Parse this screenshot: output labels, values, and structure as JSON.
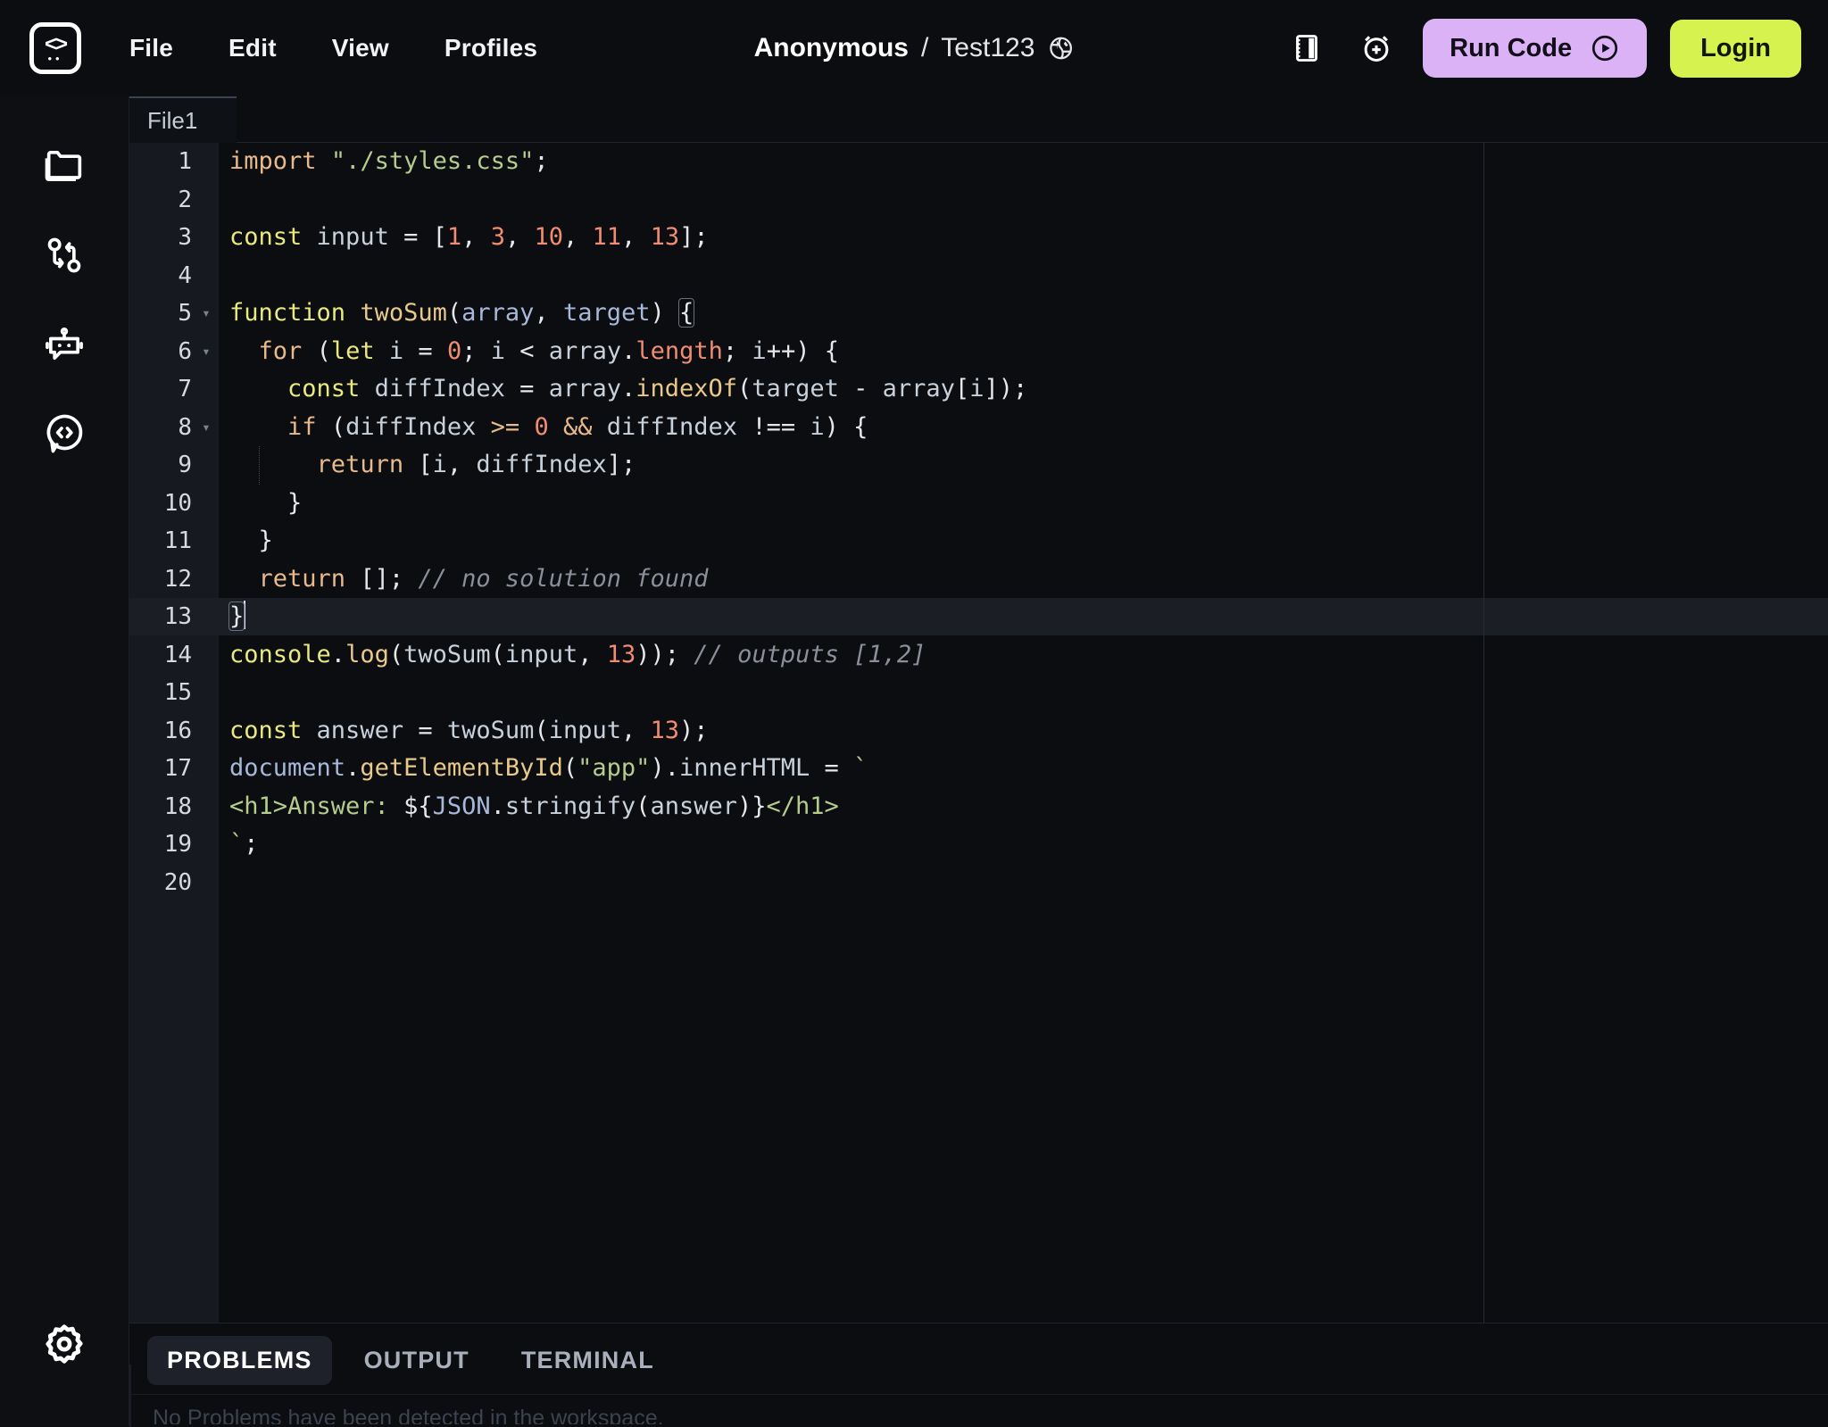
{
  "app": {
    "logo_icon": "code-brackets-logo-icon",
    "menus": [
      "File",
      "Edit",
      "View",
      "Profiles"
    ]
  },
  "header": {
    "owner": "Anonymous",
    "separator": "/",
    "project": "Test123",
    "globe_icon": "globe-icon",
    "notebook_icon": "notebook-panel-icon",
    "timer_icon": "alarm-add-icon",
    "run_label": "Run Code",
    "run_icon": "play-circle-icon",
    "run_bg": "#DBB2F5",
    "login_label": "Login",
    "login_bg": "#D6F24F"
  },
  "activity_bar": {
    "items": [
      {
        "name": "files",
        "icon": "folder-icon"
      },
      {
        "name": "source-control",
        "icon": "git-branch-icon"
      },
      {
        "name": "ai-assistant",
        "icon": "robot-icon"
      },
      {
        "name": "code-chat",
        "icon": "code-chat-bubble-icon"
      }
    ],
    "bottom": {
      "name": "settings",
      "icon": "gear-icon"
    }
  },
  "editor": {
    "tab_label": "File1",
    "active_line": 13,
    "lines": [
      {
        "n": 1,
        "fold": "",
        "html": "<span class=\"kw2\">import</span> <span class=\"str\">\"./styles.css\"</span><span class=\"pun\">;</span>"
      },
      {
        "n": 2,
        "fold": "",
        "html": ""
      },
      {
        "n": 3,
        "fold": "",
        "html": "<span class=\"kw\">const</span> <span class=\"id\">input</span> <span class=\"pun\">=</span> <span class=\"pun\">[</span><span class=\"num\">1</span><span class=\"pun\">,</span> <span class=\"num\">3</span><span class=\"pun\">,</span> <span class=\"num\">10</span><span class=\"pun\">,</span> <span class=\"num\">11</span><span class=\"pun\">,</span> <span class=\"num\">13</span><span class=\"pun\">];</span>"
      },
      {
        "n": 4,
        "fold": "",
        "html": ""
      },
      {
        "n": 5,
        "fold": "▾",
        "html": "<span class=\"kw\">function</span> <span class=\"fn\">twoSum</span><span class=\"pun\">(</span><span class=\"param\">array</span><span class=\"pun\">,</span> <span class=\"param\">target</span><span class=\"pun\">)</span> <span class=\"pun brmatch\">{</span>"
      },
      {
        "n": 6,
        "fold": "▾",
        "html": "  <span class=\"kw2\">for</span> <span class=\"pun\">(</span><span class=\"kw\">let</span> <span class=\"id\">i</span> <span class=\"pun\">=</span> <span class=\"num\">0</span><span class=\"pun\">;</span> <span class=\"id\">i</span> <span class=\"pun\">&lt;</span> <span class=\"id\">array</span><span class=\"pun\">.</span><span class=\"prop\">length</span><span class=\"pun\">;</span> <span class=\"id\">i</span><span class=\"pun\">++)</span> <span class=\"pun\">{</span>"
      },
      {
        "n": 7,
        "fold": "",
        "html": "    <span class=\"kw\">const</span> <span class=\"id\">diffIndex</span> <span class=\"pun\">=</span> <span class=\"id\">array</span><span class=\"pun\">.</span><span class=\"fn\">indexOf</span><span class=\"pun\">(</span><span class=\"id\">target</span> <span class=\"pun\">-</span> <span class=\"id\">array</span><span class=\"pun\">[</span><span class=\"id\">i</span><span class=\"pun\">]);</span>"
      },
      {
        "n": 8,
        "fold": "▾",
        "html": "    <span class=\"kw2\">if</span> <span class=\"pun\">(</span><span class=\"id\">diffIndex</span> <span class=\"kw2\">&gt;=</span> <span class=\"num\">0</span> <span class=\"kw2\">&amp;&amp;</span> <span class=\"id\">diffIndex</span> <span class=\"pun\">!==</span> <span class=\"id\">i</span><span class=\"pun\">)</span> <span class=\"pun\">{</span>"
      },
      {
        "n": 9,
        "fold": "",
        "html": "      <span class=\"kw2\">return</span> <span class=\"pun\">[</span><span class=\"id\">i</span><span class=\"pun\">,</span> <span class=\"id\">diffIndex</span><span class=\"pun\">];</span>"
      },
      {
        "n": 10,
        "fold": "",
        "html": "    <span class=\"pun\">}</span>"
      },
      {
        "n": 11,
        "fold": "",
        "html": "  <span class=\"pun\">}</span>"
      },
      {
        "n": 12,
        "fold": "",
        "html": "  <span class=\"kw2\">return</span> <span class=\"pun\">[];</span> <span class=\"cmt\">// no solution found</span>"
      },
      {
        "n": 13,
        "fold": "",
        "html": "<span class=\"pun brmatch\">}</span><span class=\"cursor\"></span>"
      },
      {
        "n": 14,
        "fold": "",
        "html": "<span class=\"kw\">console</span><span class=\"pun\">.</span><span class=\"fn\">log</span><span class=\"pun\">(</span><span class=\"id\">twoSum</span><span class=\"pun\">(</span><span class=\"id\">input</span><span class=\"pun\">,</span> <span class=\"num\">13</span><span class=\"pun\">));</span> <span class=\"cmt\">// outputs [1,2]</span>"
      },
      {
        "n": 15,
        "fold": "",
        "html": ""
      },
      {
        "n": 16,
        "fold": "",
        "html": "<span class=\"kw\">const</span> <span class=\"id\">answer</span> <span class=\"pun\">=</span> <span class=\"id\">twoSum</span><span class=\"pun\">(</span><span class=\"id\">input</span><span class=\"pun\">,</span> <span class=\"num\">13</span><span class=\"pun\">);</span>"
      },
      {
        "n": 17,
        "fold": "",
        "html": "<span class=\"obj\">document</span><span class=\"pun\">.</span><span class=\"fn\">getElementById</span><span class=\"pun\">(</span><span class=\"str\">\"app\"</span><span class=\"pun\">).</span><span class=\"id\">innerHTML</span> <span class=\"pun\">=</span> <span class=\"str\">`</span>"
      },
      {
        "n": 18,
        "fold": "",
        "html": "<span class=\"tag\">&lt;h1&gt;Answer: </span><span class=\"pun\">${</span><span class=\"obj\">JSON</span><span class=\"pun\">.</span><span class=\"id\">stringify</span><span class=\"pun\">(</span><span class=\"id\">answer</span><span class=\"pun\">)}</span><span class=\"tag\">&lt;/h1&gt;</span>"
      },
      {
        "n": 19,
        "fold": "",
        "html": "<span class=\"str\">`</span><span class=\"pun\">;</span>"
      },
      {
        "n": 20,
        "fold": "",
        "html": ""
      }
    ],
    "plain_text": [
      "import \"./styles.css\";",
      "",
      "const input = [1, 3, 10, 11, 13];",
      "",
      "function twoSum(array, target) {",
      "  for (let i = 0; i < array.length; i++) {",
      "    const diffIndex = array.indexOf(target - array[i]);",
      "    if (diffIndex >= 0 && diffIndex !== i) {",
      "      return [i, diffIndex];",
      "    }",
      "  }",
      "  return []; // no solution found",
      "}",
      "console.log(twoSum(input, 13)); // outputs [1,2]",
      "",
      "const answer = twoSum(input, 13);",
      "document.getElementById(\"app\").innerHTML = `",
      "<h1>Answer: ${JSON.stringify(answer)}</h1>",
      "`;",
      ""
    ]
  },
  "panel": {
    "tabs": [
      {
        "label": "PROBLEMS",
        "active": true
      },
      {
        "label": "OUTPUT",
        "active": false
      },
      {
        "label": "TERMINAL",
        "active": false
      }
    ],
    "message": "No Problems have been detected in the workspace."
  }
}
